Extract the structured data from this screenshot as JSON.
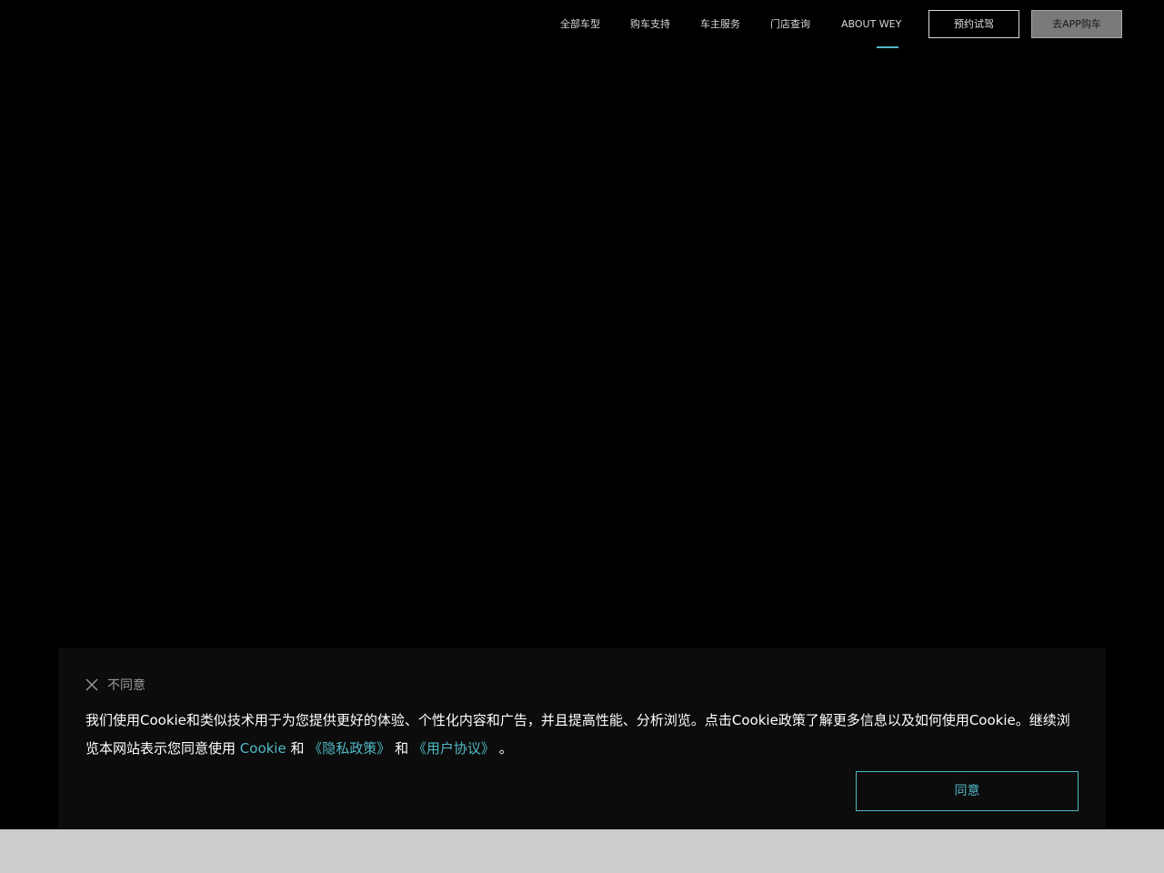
{
  "nav": {
    "items": [
      {
        "label": "全部车型"
      },
      {
        "label": "购车支持"
      },
      {
        "label": "车主服务"
      },
      {
        "label": "门店查询"
      },
      {
        "label": "ABOUT WEY"
      }
    ],
    "active_item": "ABOUT WEY",
    "test_drive_button": "预约试驾",
    "app_buy_button": "去APP购车"
  },
  "cookie": {
    "disagree_label": "不同意",
    "text_main": "我们使用Cookie和类似技术用于为您提供更好的体验、个性化内容和广告，并且提高性能、分析浏览。点击Cookie政策了解更多信息以及如何使用Cookie。继续浏览本网站表示您同意使用",
    "link_cookie": "Cookie",
    "conj1": "和",
    "link_privacy": "《隐私政策》",
    "conj2": "和",
    "link_user_agreement": "《用户协议》",
    "period": "。",
    "agree_button": "同意"
  },
  "colors": {
    "accent": "#4fb8c4",
    "background": "#000000",
    "panel": "#0c0c0c"
  }
}
